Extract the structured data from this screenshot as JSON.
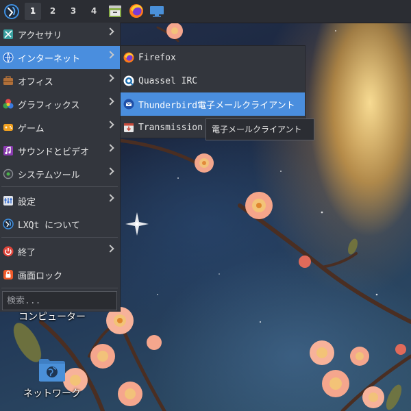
{
  "panel": {
    "main_menu_icon": "lxqt-logo-icon",
    "workspaces": [
      "1",
      "2",
      "3",
      "4"
    ],
    "active_workspace": "1",
    "quicklaunch_icons": [
      "file-manager-icon",
      "firefox-icon",
      "show-desktop-icon"
    ]
  },
  "main_menu": {
    "items": [
      {
        "label": "アクセサリ",
        "icon": "accessories-icon",
        "has_submenu": true
      },
      {
        "label": "インターネット",
        "icon": "internet-icon",
        "has_submenu": true
      },
      {
        "label": "オフィス",
        "icon": "office-icon",
        "has_submenu": true
      },
      {
        "label": "グラフィックス",
        "icon": "graphics-icon",
        "has_submenu": true
      },
      {
        "label": "ゲーム",
        "icon": "games-icon",
        "has_submenu": true
      },
      {
        "label": "サウンドとビデオ",
        "icon": "multimedia-icon",
        "has_submenu": true
      },
      {
        "label": "システムツール",
        "icon": "system-tools-icon",
        "has_submenu": true
      },
      {
        "label": "設定",
        "icon": "settings-icon",
        "has_submenu": true
      },
      {
        "label": "LXQt について",
        "icon": "lxqt-about-icon",
        "has_submenu": false
      },
      {
        "label": "終了",
        "icon": "power-icon",
        "has_submenu": true
      },
      {
        "label": "画面ロック",
        "icon": "lock-icon",
        "has_submenu": false
      }
    ],
    "highlighted": "インターネット",
    "search": {
      "placeholder": "検索...",
      "value": ""
    }
  },
  "internet_submenu": {
    "items": [
      {
        "label": "Firefox",
        "icon": "firefox-icon"
      },
      {
        "label": "Quassel IRC",
        "icon": "quassel-icon"
      },
      {
        "label": "Thunderbird電子メールクライアント",
        "icon": "thunderbird-icon"
      },
      {
        "label": "Transmission (Qt)",
        "icon": "transmission-icon"
      }
    ],
    "highlighted": "Thunderbird電子メールクライアント"
  },
  "tooltip": {
    "text": "電子メールクライアント"
  },
  "desktop": {
    "icons": [
      {
        "label": "コンピューター",
        "icon": "computer-icon"
      },
      {
        "label": "ネットワーク",
        "icon": "network-folder-icon"
      }
    ]
  },
  "colors": {
    "panel_bg": "#2b2d33",
    "menu_bg": "#33363d",
    "highlight": "#4a8ede"
  }
}
